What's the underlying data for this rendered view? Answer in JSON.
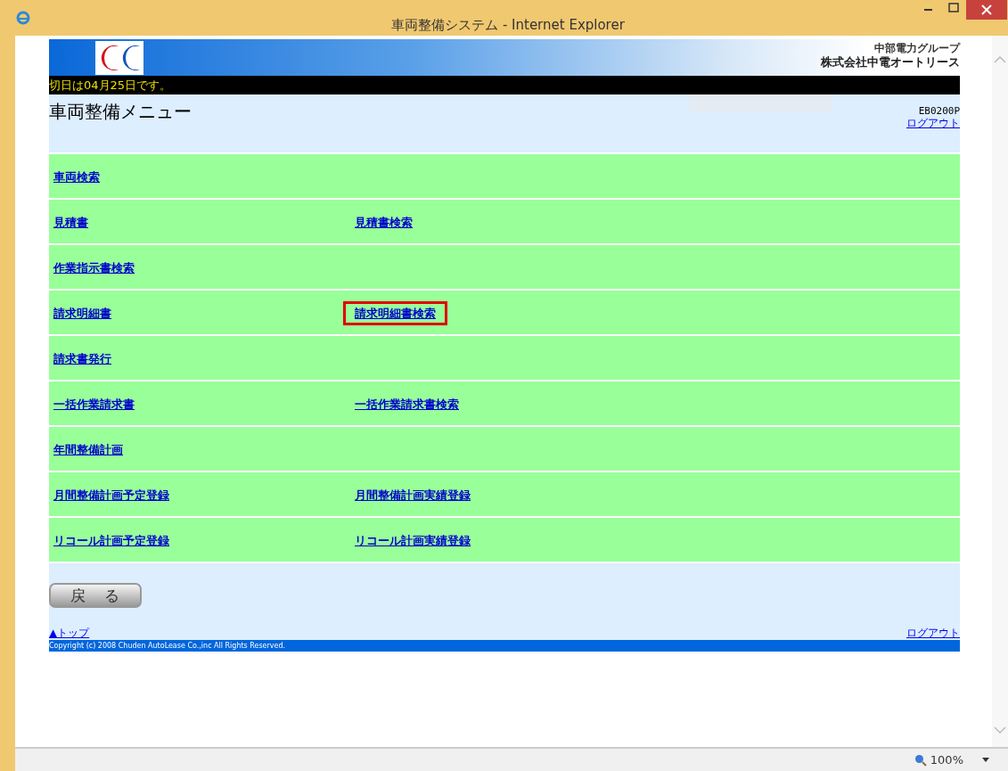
{
  "window": {
    "title": "車両整備システム - Internet Explorer"
  },
  "header": {
    "group_name": "中部電力グループ",
    "company": "株式会社中電オートリース"
  },
  "notice": "切日は04月25日です。",
  "page": {
    "title": "車両整備メニュー",
    "screen_id": "EB0200P",
    "logout": "ログアウト"
  },
  "menu_rows": [
    {
      "links": [
        {
          "label": "車両検索",
          "highlighted": false
        }
      ]
    },
    {
      "links": [
        {
          "label": "見積書",
          "highlighted": false
        },
        {
          "label": "見積書検索",
          "highlighted": false
        }
      ]
    },
    {
      "links": [
        {
          "label": "作業指示書検索",
          "highlighted": false
        }
      ]
    },
    {
      "links": [
        {
          "label": "請求明細書",
          "highlighted": false
        },
        {
          "label": "請求明細書検索",
          "highlighted": true
        }
      ]
    },
    {
      "links": [
        {
          "label": "請求書発行",
          "highlighted": false
        }
      ]
    },
    {
      "links": [
        {
          "label": "一括作業請求書",
          "highlighted": false
        },
        {
          "label": "一括作業請求書検索",
          "highlighted": false
        }
      ]
    },
    {
      "links": [
        {
          "label": "年間整備計画",
          "highlighted": false
        }
      ]
    },
    {
      "links": [
        {
          "label": "月間整備計画予定登録",
          "highlighted": false
        },
        {
          "label": "月間整備計画実績登録",
          "highlighted": false
        }
      ]
    },
    {
      "links": [
        {
          "label": "リコール計画予定登録",
          "highlighted": false
        },
        {
          "label": "リコール計画実績登録",
          "highlighted": false
        }
      ]
    }
  ],
  "back_button": "戻　る",
  "footer": {
    "top_link": "▲トップ",
    "logout": "ログアウト",
    "copyright": "Copyright (c) 2008 Chuden AutoLease Co.,inc All Rights Reserved."
  },
  "status_bar": {
    "zoom": "100%"
  }
}
